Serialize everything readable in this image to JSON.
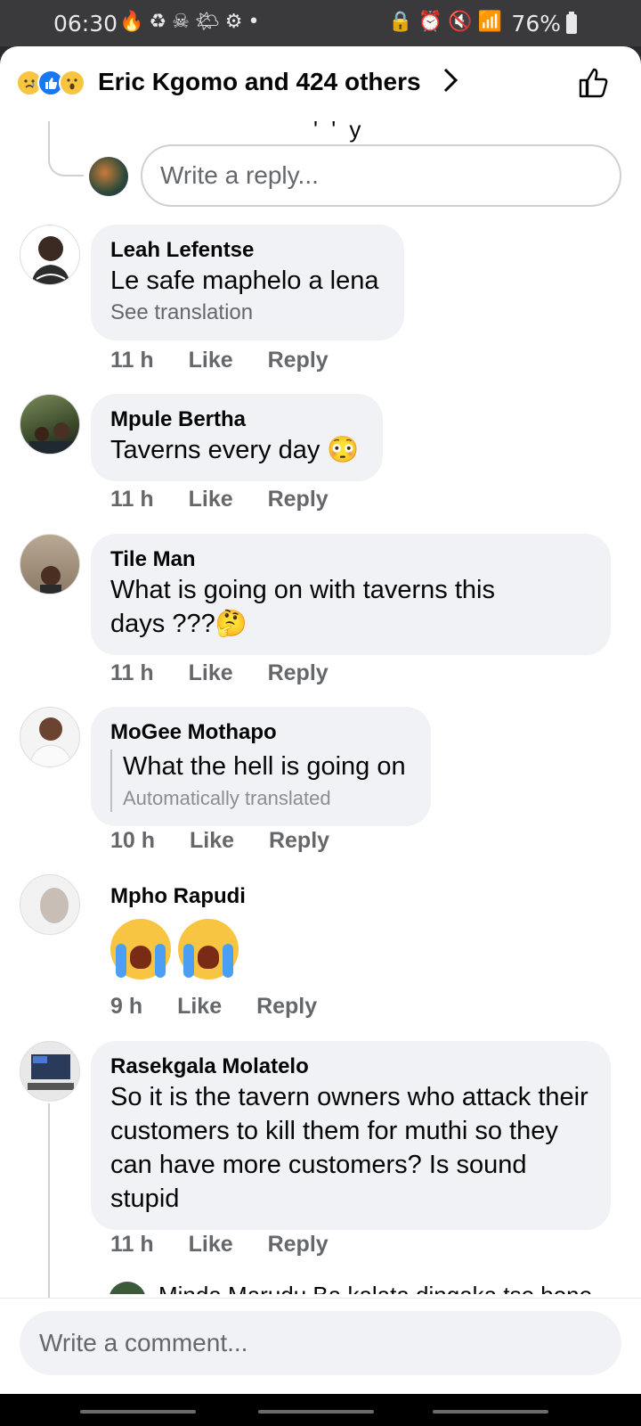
{
  "status_bar": {
    "time": "06:30",
    "left_icons": "🔥♻☠🌤⚙•",
    "right_icons": "🔒⏰🔇📶",
    "battery": "76%"
  },
  "header": {
    "title": "Eric Kgomo and 424 others"
  },
  "reply_box": {
    "placeholder": "Write a reply..."
  },
  "comments": [
    {
      "author": "Leah Lefentse",
      "text": "Le safe maphelo a lena",
      "sub": "See translation",
      "time": "11 h",
      "like": "Like",
      "reply": "Reply"
    },
    {
      "author": "Mpule Bertha",
      "text": "Taverns every day 😳",
      "time": "11 h",
      "like": "Like",
      "reply": "Reply"
    },
    {
      "author": "Tile Man",
      "text": "What is going on with taverns this days ???🤔",
      "time": "11 h",
      "like": "Like",
      "reply": "Reply"
    },
    {
      "author": "MoGee Mothapo",
      "text": "What the hell is going on",
      "sub": "Automatically translated",
      "time": "10 h",
      "like": "Like",
      "reply": "Reply"
    },
    {
      "author": "Mpho Rapudi",
      "text": "😭😭",
      "time": "9 h",
      "like": "Like",
      "reply": "Reply"
    },
    {
      "author": "Rasekgala Molatelo",
      "text": "So it is the tavern owners who attack their customers to kill them for muthi so they can have more customers? Is sound stupid",
      "time": "11 h",
      "like": "Like",
      "reply": "Reply"
    }
  ],
  "peek_reply": {
    "text": "Minda Marudu  Ba kalata dingaka tse bone"
  },
  "footer": {
    "placeholder": "Write a comment..."
  }
}
